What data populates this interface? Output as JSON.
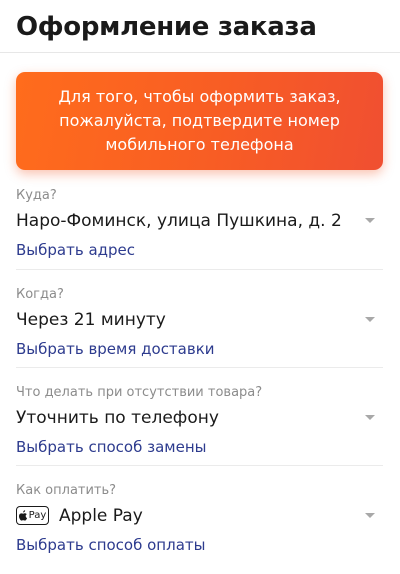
{
  "header": {
    "title": "Оформление заказа"
  },
  "banner": {
    "text": "Для того, чтобы оформить заказ, пожалуйста, подтвердите номер мобильного телефона"
  },
  "sections": [
    {
      "label": "Куда?",
      "value": "Наро-Фоминск, улица Пушкина, д. 2",
      "action": "Выбрать адрес"
    },
    {
      "label": "Когда?",
      "value": "Через 21 минуту",
      "action": "Выбрать время доставки"
    },
    {
      "label": "Что делать при отсутствии товара?",
      "value": "Уточнить по телефону",
      "action": "Выбрать способ замены"
    },
    {
      "label": "Как оплатить?",
      "value": "Apple Pay",
      "action": "Выбрать способ оплаты",
      "badge_text": "Pay",
      "badge_icon": "apple-icon"
    }
  ],
  "colors": {
    "accent": "#f85d24",
    "link": "#2d3b8e",
    "label": "#8c8c8c",
    "text": "#1a1a1a"
  }
}
